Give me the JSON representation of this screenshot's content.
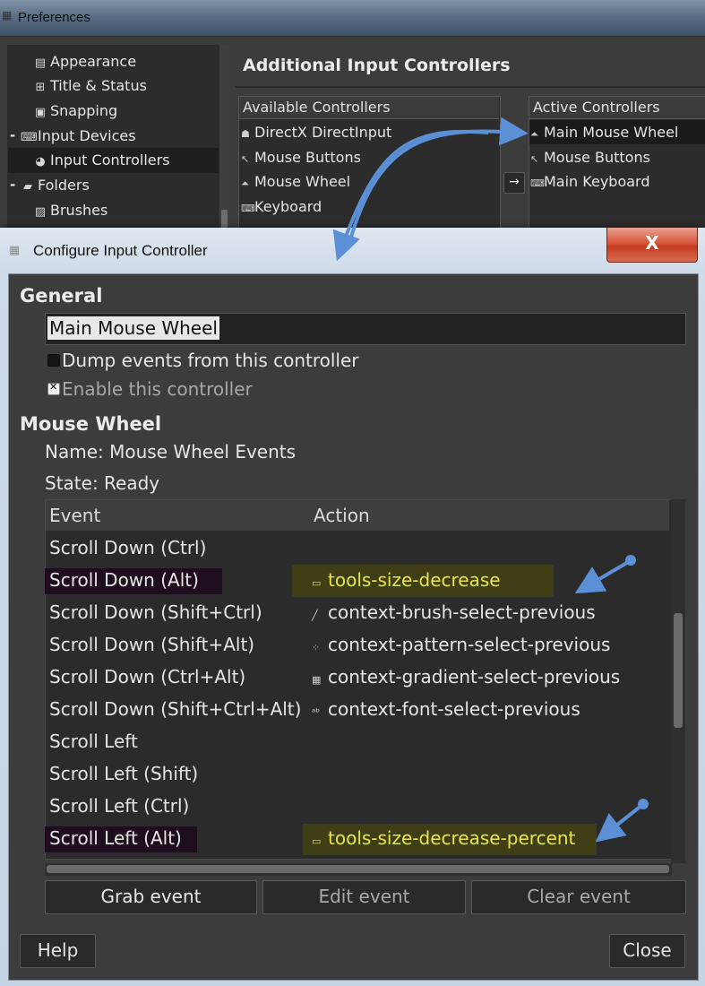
{
  "preferences": {
    "title": "Preferences",
    "tree": [
      {
        "label": "Appearance",
        "icon": "appearance-icon"
      },
      {
        "label": "Title & Status",
        "icon": "title-status-icon"
      },
      {
        "label": "Snapping",
        "icon": "snapping-icon"
      },
      {
        "label": "Input Devices",
        "icon": "input-devices-icon"
      },
      {
        "label": "Input Controllers",
        "icon": "input-controllers-icon"
      },
      {
        "label": "Folders",
        "icon": "folders-icon"
      },
      {
        "label": "Brushes",
        "icon": "brushes-icon"
      }
    ],
    "panel_title": "Additional Input Controllers",
    "available": {
      "header": "Available Controllers",
      "items": [
        "DirectX DirectInput",
        "Mouse Buttons",
        "Mouse Wheel",
        "Keyboard"
      ]
    },
    "arrow": "→",
    "active": {
      "header": "Active Controllers",
      "items": [
        "Main Mouse Wheel",
        "Mouse Buttons",
        "Main Keyboard"
      ]
    }
  },
  "dialog": {
    "title": "Configure Input Controller",
    "close_glyph": "X",
    "general_title": "General",
    "name_value": "Main Mouse Wheel",
    "dump_label": "Dump events from this controller",
    "enable_label": "Enable this controller",
    "mouse_title": "Mouse Wheel",
    "name_info": "Name: Mouse Wheel Events",
    "state_info": "State:  Ready",
    "table": {
      "headers": {
        "event": "Event",
        "action": "Action"
      },
      "rows": [
        {
          "event": "Scroll Down (Ctrl)",
          "action": "",
          "icon": ""
        },
        {
          "event": "Scroll Down (Alt)",
          "action": "tools-size-decrease",
          "icon": "tool-size-icon",
          "highlight": true
        },
        {
          "event": "Scroll Down (Shift+Ctrl)",
          "action": "context-brush-select-previous",
          "icon": "brush-icon"
        },
        {
          "event": "Scroll Down (Shift+Alt)",
          "action": "context-pattern-select-previous",
          "icon": "pattern-icon"
        },
        {
          "event": "Scroll Down (Ctrl+Alt)",
          "action": "context-gradient-select-previous",
          "icon": "gradient-icon"
        },
        {
          "event": "Scroll Down (Shift+Ctrl+Alt)",
          "action": "context-font-select-previous",
          "icon": "font-icon"
        },
        {
          "event": "Scroll Left",
          "action": "",
          "icon": ""
        },
        {
          "event": "Scroll Left (Shift)",
          "action": "",
          "icon": ""
        },
        {
          "event": "Scroll Left (Ctrl)",
          "action": "",
          "icon": ""
        },
        {
          "event": "Scroll Left (Alt)",
          "action": "tools-size-decrease-percent",
          "icon": "tool-size-icon",
          "highlight": true
        }
      ]
    },
    "buttons": {
      "grab": "Grab event",
      "edit": "Edit event",
      "clear": "Clear event",
      "help": "Help",
      "close": "Close"
    }
  },
  "colors": {
    "annotation_arrow": "#5b8fd6",
    "highlight_action": "#e7e54b"
  }
}
